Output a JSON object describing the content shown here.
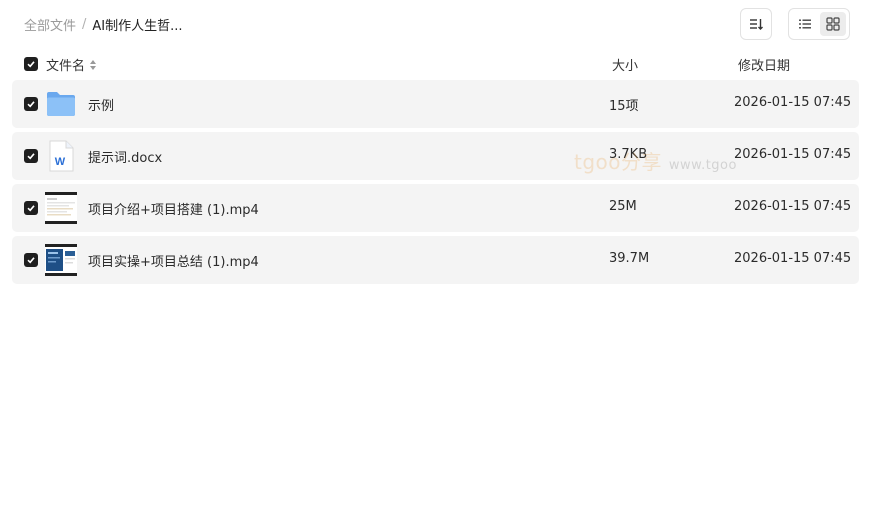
{
  "breadcrumb": {
    "root": "全部文件",
    "separator": "/",
    "current": "AI制作人生哲..."
  },
  "toolbar": {
    "sort_icon": "sort-desc-icon",
    "list_view_icon": "list-view-icon",
    "grid_view_icon": "grid-view-icon",
    "active_view": "grid"
  },
  "columns": {
    "name": "文件名",
    "size": "大小",
    "date": "修改日期"
  },
  "files": [
    {
      "name": "示例",
      "size": "15项",
      "date": "2026-01-15 07:45",
      "type": "folder",
      "icon": "folder-icon"
    },
    {
      "name": "提示词.docx",
      "size": "3.7KB",
      "date": "2026-01-15 07:45",
      "type": "docx",
      "icon": "word-doc-icon"
    },
    {
      "name": "项目介绍+项目搭建 (1).mp4",
      "size": "25M",
      "date": "2026-01-15 07:45",
      "type": "video",
      "icon": "video-thumbnail-icon"
    },
    {
      "name": "项目实操+项目总结 (1).mp4",
      "size": "39.7M",
      "date": "2026-01-15 07:45",
      "type": "video",
      "icon": "video-thumbnail-icon"
    }
  ],
  "watermark": {
    "brand": "tgoo分享",
    "url": "www.tgoo"
  },
  "colors": {
    "row_bg": "#f4f4f4",
    "checkbox": "#1f1f1f",
    "folder": "#7fb8f5",
    "word": "#2b6fd6"
  }
}
